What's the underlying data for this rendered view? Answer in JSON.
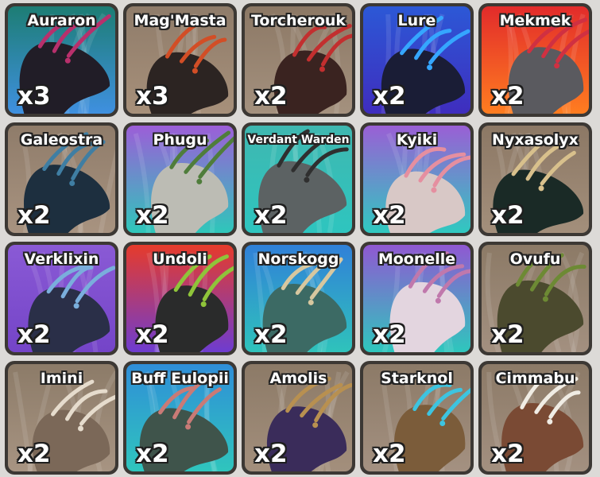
{
  "items": [
    {
      "name": "Auraron",
      "count": "x3",
      "bg_top": "#1d7d74",
      "bg_bottom": "#3f90e0",
      "creature": "#211d27",
      "accent": "#b8306c",
      "icon": "auraron-creature-icon"
    },
    {
      "name": "Mag'Masta",
      "count": "x3",
      "bg_top": "#8f7c6a",
      "bg_bottom": "#a7907a",
      "creature": "#2c2422",
      "accent": "#d24e26",
      "icon": "magmasta-creature-icon"
    },
    {
      "name": "Torcherouk",
      "count": "x2",
      "bg_top": "#8c7865",
      "bg_bottom": "#a4917e",
      "creature": "#3a2320",
      "accent": "#c22f2f",
      "icon": "torcherouk-creature-icon"
    },
    {
      "name": "Lure",
      "count": "x2",
      "bg_top": "#2c58d6",
      "bg_bottom": "#3f2dbe",
      "creature": "#1a1d36",
      "accent": "#35a6ff",
      "icon": "lure-creature-icon"
    },
    {
      "name": "Mekmek",
      "count": "x2",
      "bg_top": "#e22b2b",
      "bg_bottom": "#ff7d20",
      "creature": "#5a5a5f",
      "accent": "#d03041",
      "icon": "mekmek-creature-icon"
    },
    {
      "name": "Galeostra",
      "count": "x2",
      "bg_top": "#8f7c6a",
      "bg_bottom": "#a89380",
      "creature": "#1d2f3f",
      "accent": "#3f7ea3",
      "icon": "galeostra-creature-icon"
    },
    {
      "name": "Phugu",
      "count": "x2",
      "bg_top": "#9c5ed8",
      "bg_bottom": "#2ec7ba",
      "creature": "#bcbcb4",
      "accent": "#4f7d3b",
      "icon": "phugu-creature-icon"
    },
    {
      "name": "Verdant Warden",
      "count": "x2",
      "bg_top": "#3fb7b0",
      "bg_bottom": "#2ec5bf",
      "creature": "#5c6263",
      "accent": "#2f2f2f",
      "icon": "verdant-warden-creature-icon"
    },
    {
      "name": "Kyiki",
      "count": "x2",
      "bg_top": "#9a5fd5",
      "bg_bottom": "#2fc9c0",
      "creature": "#d8c8c6",
      "accent": "#e58fa0",
      "icon": "kyiki-creature-icon"
    },
    {
      "name": "Nyxasolyx",
      "count": "x2",
      "bg_top": "#8c7865",
      "bg_bottom": "#a38f7b",
      "creature": "#1a2a26",
      "accent": "#d8c08c",
      "icon": "nyxasolyx-creature-icon"
    },
    {
      "name": "Verklixin",
      "count": "x2",
      "bg_top": "#8a5ad5",
      "bg_bottom": "#7444c8",
      "creature": "#2a2f48",
      "accent": "#7aaedc",
      "icon": "verklixin-creature-icon"
    },
    {
      "name": "Undoli",
      "count": "x2",
      "bg_top": "#e63b2b",
      "bg_bottom": "#6e3cd0",
      "creature": "#2a2b2b",
      "accent": "#8fc43a",
      "icon": "undoli-creature-icon"
    },
    {
      "name": "Norskogg",
      "count": "x2",
      "bg_top": "#3080d8",
      "bg_bottom": "#2fc3bb",
      "creature": "#3c6a64",
      "accent": "#d7c79f",
      "icon": "norskogg-creature-icon"
    },
    {
      "name": "Moonelle",
      "count": "x2",
      "bg_top": "#9058d2",
      "bg_bottom": "#2ec7bd",
      "creature": "#e3d5df",
      "accent": "#c078ac",
      "icon": "moonelle-creature-icon"
    },
    {
      "name": "Ovufu",
      "count": "x2",
      "bg_top": "#8c7a66",
      "bg_bottom": "#a39080",
      "creature": "#4b4a2e",
      "accent": "#6d8a34",
      "icon": "ovufu-creature-icon"
    },
    {
      "name": "Imini",
      "count": "x2",
      "bg_top": "#8c7b68",
      "bg_bottom": "#a79482",
      "creature": "#7b6858",
      "accent": "#e6dccd",
      "icon": "imini-creature-icon"
    },
    {
      "name": "Buff Eulopii",
      "count": "x2",
      "bg_top": "#2f8ed8",
      "bg_bottom": "#2fc5bd",
      "creature": "#3f544b",
      "accent": "#c97a76",
      "icon": "buff-eulopii-creature-icon"
    },
    {
      "name": "Amolis",
      "count": "x2",
      "bg_top": "#8c7a67",
      "bg_bottom": "#a38f7c",
      "creature": "#3a2c5a",
      "accent": "#b89050",
      "icon": "amolis-creature-icon"
    },
    {
      "name": "Starknol",
      "count": "x2",
      "bg_top": "#8c7a67",
      "bg_bottom": "#a49181",
      "creature": "#7b5c3a",
      "accent": "#3dc4e0",
      "icon": "starknol-creature-icon"
    },
    {
      "name": "Cimmabu",
      "count": "x2",
      "bg_top": "#8c7a67",
      "bg_bottom": "#a39080",
      "creature": "#7a4a34",
      "accent": "#f0ece4",
      "icon": "cimmabu-creature-icon"
    }
  ]
}
